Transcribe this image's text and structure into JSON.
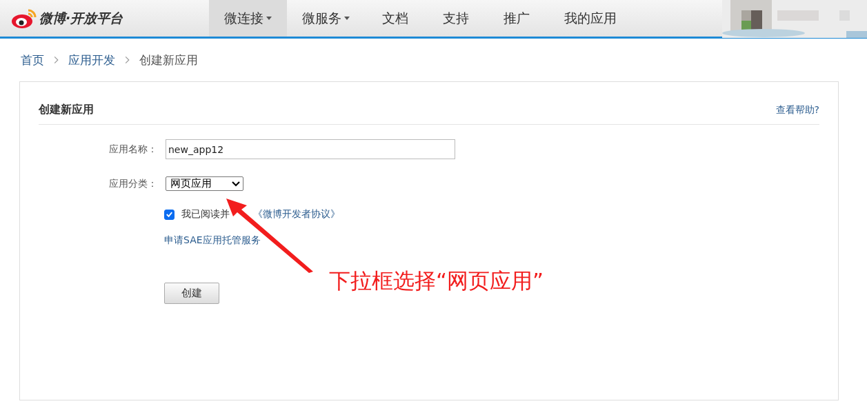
{
  "header": {
    "logo": "微博·开放平台",
    "nav": [
      {
        "label": "微连接",
        "dropdown": true,
        "selected": true
      },
      {
        "label": "微服务",
        "dropdown": true,
        "selected": false
      },
      {
        "label": "文档",
        "dropdown": false,
        "selected": false
      },
      {
        "label": "支持",
        "dropdown": false,
        "selected": false
      },
      {
        "label": "推广",
        "dropdown": false,
        "selected": false
      },
      {
        "label": "我的应用",
        "dropdown": false,
        "selected": false
      }
    ]
  },
  "breadcrumb": [
    {
      "label": "首页",
      "kind": "link"
    },
    {
      "label": "应用开发",
      "kind": "link"
    },
    {
      "label": "创建新应用",
      "kind": "current"
    }
  ],
  "panel": {
    "title": "创建新应用",
    "help": "查看帮助?",
    "form": {
      "name_label": "应用名称：",
      "name_value": "new_app12",
      "category_label": "应用分类：",
      "category_value": "网页应用",
      "agree": {
        "checked": true,
        "text": "我已阅读并",
        "link": "《微博开发者协议》"
      },
      "sae_link": "申请SAE应用托管服务",
      "submit": "创建"
    }
  },
  "annotation": {
    "text": "下拉框选择“网页应用”"
  }
}
